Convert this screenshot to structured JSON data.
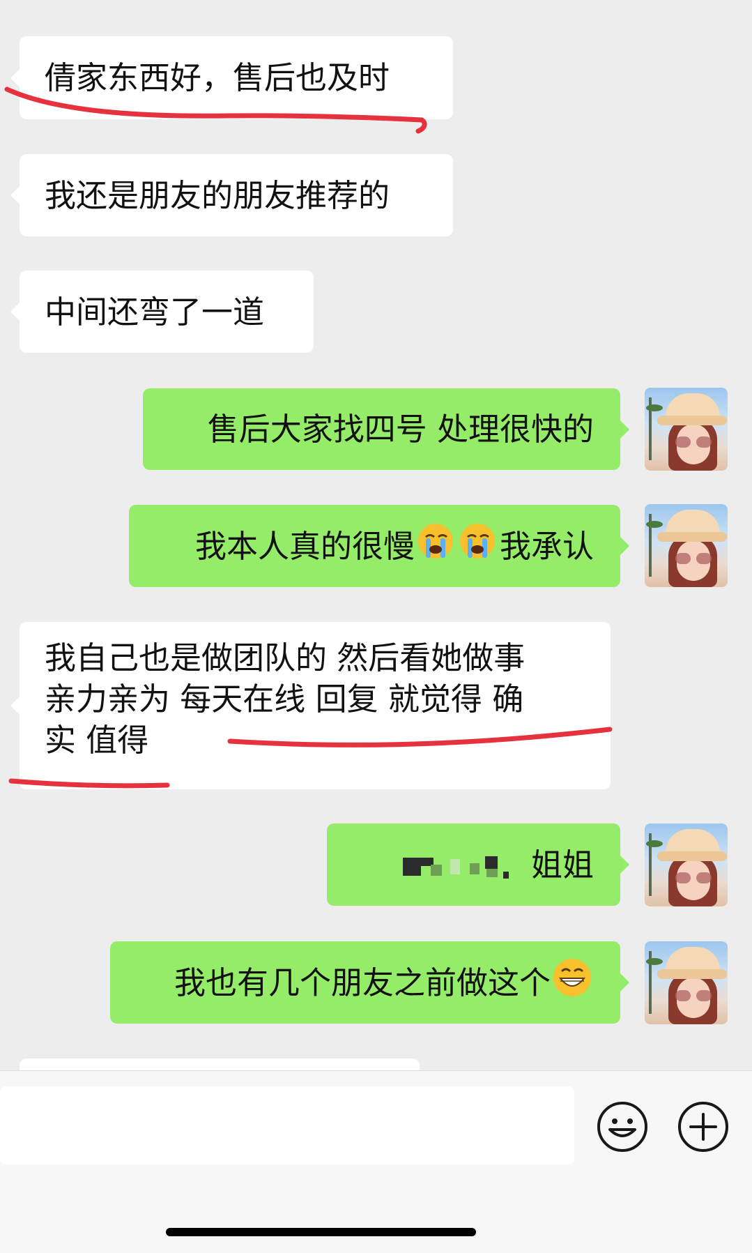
{
  "messages": [
    {
      "side": "in",
      "text": "倩家东西好，售后也及时"
    },
    {
      "side": "in",
      "text": "我还是朋友的朋友推荐的"
    },
    {
      "side": "in",
      "text": "中间还弯了一道"
    },
    {
      "side": "out",
      "text": "售后大家找四号 处理很快的"
    },
    {
      "side": "out",
      "text_before": "我本人真的很慢",
      "emoji": "crying-face-emoji",
      "text_after": "我承认"
    },
    {
      "side": "in",
      "lines": [
        "我自己也是做团队的  然后看她做事",
        "亲力亲为 每天在线 回复 就觉得 确",
        "实 值得"
      ]
    },
    {
      "side": "out",
      "text_visible": "姐姐",
      "redacted": true
    },
    {
      "side": "out",
      "text": "我也有几个朋友之前做这个",
      "emoji": "grinning-face-emoji"
    }
  ],
  "input": {
    "placeholder": ""
  },
  "icons": {
    "emoji_button": "smiley-icon",
    "more_button": "plus-circle-icon"
  },
  "colors": {
    "background": "#ededed",
    "incoming": "#ffffff",
    "outgoing": "#95ec69",
    "annotation": "#e5323e"
  }
}
